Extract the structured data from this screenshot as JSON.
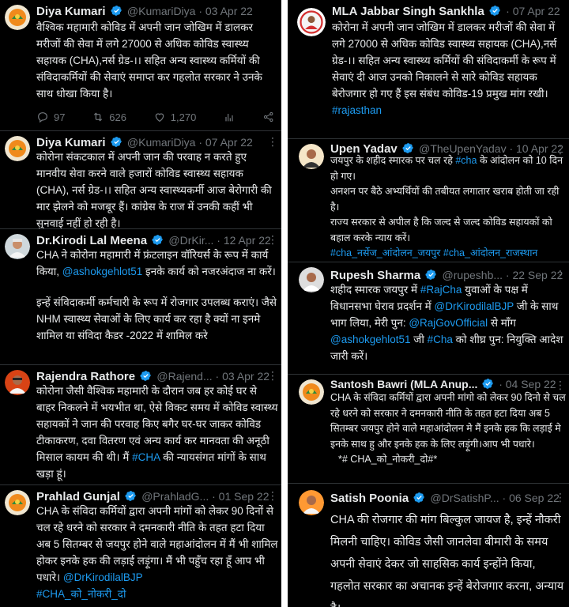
{
  "left": [
    {
      "name": "Diya Kumari",
      "handle": "@KumariDiya · 03 Apr 22",
      "text": "वैश्विक महामारी कोविड में अपनी जान जोखिम में डालकर मरीजों की सेवा में लगे 27000 से अधिक कोविड स्वास्थ्य सहायक (CHA),नर्स ग्रेड-।। सहित अन्य स्वास्थ्य कर्मियों की संविदाकर्मियों की सेवाएं समाप्त कर गहलोत सरकार ने उनके साथ धोखा किया है।",
      "replies": "97",
      "retweets": "626",
      "likes": "1,270"
    },
    {
      "name": "Diya Kumari",
      "handle": "@KumariDiya · 07 Apr 22",
      "text": "कोरोना संकटकाल में अपनी जान की परवाह न करते हुए मानवीय सेवा करने वाले हजारों कोविड स्वास्थ्य सहायक (CHA), नर्स ग्रेड-।। सहित अन्य स्वास्थ्यकर्मी आज बेरोगारी की मार झेलने को मजबूर हैं। कांग्रेस के राज में उनकी कहीं भी सुनवाई नहीं हो रही है।"
    },
    {
      "name": "Dr.Kirodi Lal Meena",
      "handle": "@DrKir... · 12 Apr 22",
      "text1": "CHA ने कोरोना महामारी में फ्रंटलाइन वॉरियर्स के रूप में कार्य किया,",
      "mention": "@ashokgehlot51",
      "text2": "इनके कार्य को नजरअंदाज ना करें।",
      "text3": "इन्हें संविदाकर्मी कर्मचारी के रूप में रोजगार उपलब्ध कराएं। जैसे NHM स्वास्थ्य सेवाओं के लिए कार्य कर रहा है क्यों ना इनमे शामिल या संविदा कैडर -2022 में शामिल करे"
    },
    {
      "name": "Rajendra Rathore",
      "handle": "@Rajend... · 03 Apr 22",
      "text1": "कोरोना जैसी वैश्विक महामारी के दौरान जब हर कोई घर से बाहर निकलने में भयभीत था, ऐसे विकट समय में कोविड स्वास्थ्य सहायकों ने जान की परवाह किए बगैर घर-घर जाकर कोविड टीकाकरण, दवा वितरण एवं अन्य कार्य कर मानवता की अनूठी मिसाल कायम की थी। मैं",
      "hashtag": "#CHA",
      "text2": "की न्यायसंगत मांगों के साथ खड़ा हूं।"
    },
    {
      "name": "Prahlad Gunjal",
      "handle": "@PrahladG... · 01 Sep 22",
      "text": "CHA के संविदा कर्मियों द्वारा अपनी मांगों को लेकर 90 दिनों से चल रहे धरने को सरकार ने दमनकारी नीति के तहत हटा दिया अब 5 सितम्बर से जयपुर होने वाले महाआंदोलन में मैं भी शामिल होकर इनके हक की लड़ाई लड़ूंगा। मैं भी पहुँच रहा हूँ आप भी पधारे।",
      "mention": "@DrKirodilalBJP",
      "hashtag": "#CHA_को_नोकरी_दो"
    }
  ],
  "right": [
    {
      "name": "MLA Jabbar Singh Sankhla",
      "handle": "· 07 Apr 22",
      "text": "कोरोना में अपनी जान जोखिम में डालकर मरीजों की सेवा में लगे 27000 से अधिक कोविड स्वास्थ्य सहायक (CHA),नर्स ग्रेड-।। सहित अन्य स्वास्थ्य कर्मियों की संविदाकर्मी के रूप में सेवाएं दी आज उनको निकालने से सारे कोविड सहायक बेरोजगार हो गए हैं इस संबंध कोविड-19 प्रमुख मांग रखी।",
      "hashtag": "#rajasthan"
    },
    {
      "name": "Upen Yadav",
      "handle": "@TheUpenYadav · 10 Apr 22",
      "text1": "जयपुर के शहीद स्मारक पर चल रहे",
      "hashtag1": "#cha",
      "text2": "के आंदोलन को 10 दिन हो गए।",
      "text3": "अनशन पर बैठे अभ्यर्थियों की तबीयत लगातार खराब होती जा रही है।",
      "text4": "राज्य सरकार से अपील है कि जल्द से जल्द कोविड सहायकों को बहाल करके न्याय करें।",
      "hashtag2": "#cha_नर्सेज_आंदोलन_जयपुर #cha_आंदोलन_राजस्थान"
    },
    {
      "name": "Rupesh Sharma",
      "handle": "@rupeshb... · 22 Sep 22",
      "text1": "शहीद स्मारक जयपुर में",
      "hashtag1": "#RajCha",
      "text2": "युवाओं के पक्ष में विधानसभा घेराव प्रदर्शन में",
      "mention1": "@DrKirodilalBJP",
      "text3": "जी के साथ भाग लिया, मेरी पुन:",
      "mention2": "@RajGovOfficial",
      "text4": "से माँग",
      "mention3": "@ashokgehlot51",
      "text5": "जी",
      "hashtag2": "#Cha",
      "text6": "को शीघ्र पुन: नियुक्ति आदेश जारी करें।"
    },
    {
      "name": "Santosh Bawri (MLA Anup...",
      "handle": "· 04 Sep 22",
      "text": "CHA के संविदा कर्मियों द्वारा अपनी मांगो को लेकर 90 दिनो से चल रहे धरने को सरकार ने दमनकारी नीति के तहत हटा दिया अब 5 सितम्बर जयपुर होने वाले महाआंदोलन मे मैं इनके हक कि लड़ाई मे इनके साथ हु और इनके हक के लिए लड़ूंगी।आप भी पधारे।",
      "tag": "*# CHA_को_नोकरी_दो#*"
    },
    {
      "name": "Satish Poonia",
      "handle": "@DrSatishP... · 06 Sep 22",
      "text": "CHA की रोजगार की मांग बिल्कुल जायज है, इन्हें नौकरी मिलनी चाहिए। कोविड जैसी जानलेवा बीमारी के समय अपनी सेवाएं देकर जो साहसिक कार्य इन्होंने किया, गहलोत सरकार का अचानक इन्हें बेरोजगार करना, अन्याय है।"
    }
  ],
  "colors": {
    "bg": "#000000",
    "text": "#e7e9ea",
    "muted": "#71767b",
    "link": "#1d9bf0",
    "verified": "#1d9bf0"
  },
  "icons": [
    "verified-badge-icon",
    "reply-icon",
    "retweet-icon",
    "like-icon",
    "views-icon",
    "share-icon",
    "more-icon"
  ]
}
